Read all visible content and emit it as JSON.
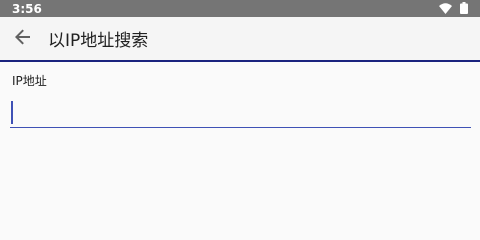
{
  "status_bar": {
    "time": "3:56",
    "icons": [
      "wifi-icon",
      "battery-icon"
    ]
  },
  "app_bar": {
    "title": "以IP地址搜索",
    "back_icon": "arrow-back-icon"
  },
  "form": {
    "ip_label": "IP地址",
    "ip_value": "",
    "accent_color": "#3f51b5"
  }
}
